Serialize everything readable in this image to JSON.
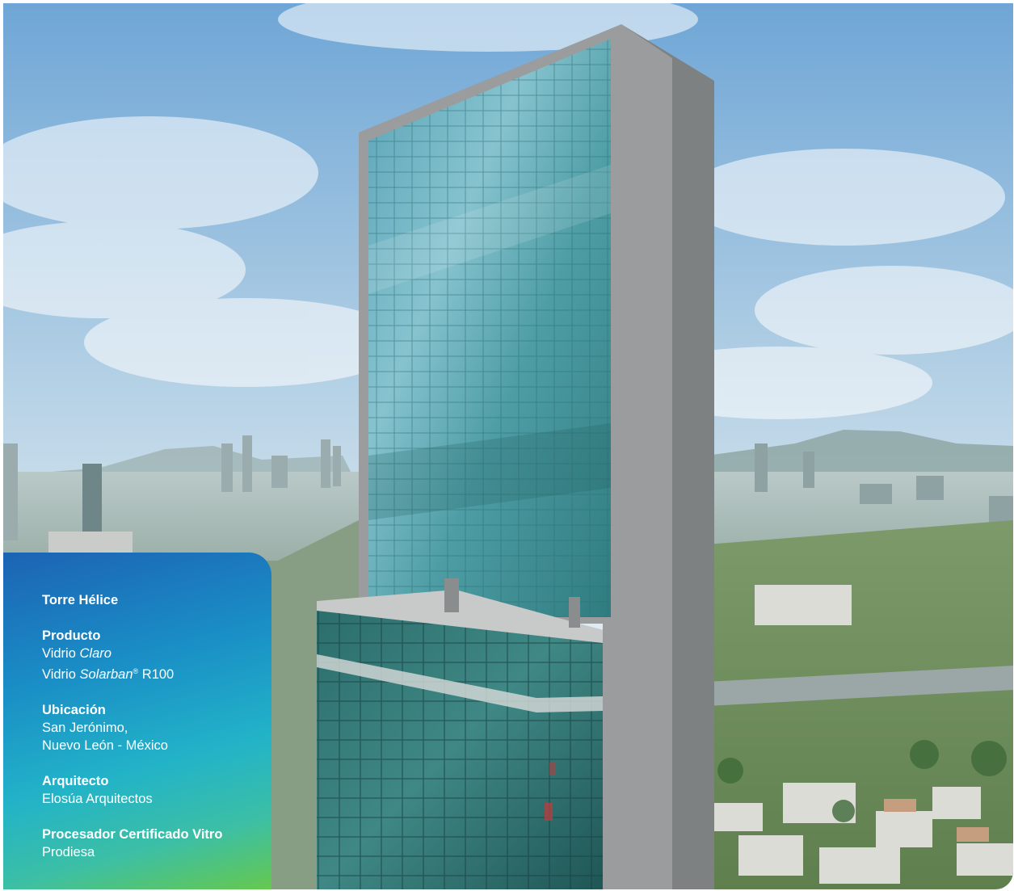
{
  "project": {
    "title": "Torre Hélice",
    "sections": [
      {
        "heading": "Producto",
        "lines": [
          {
            "prefix": "Vidrio ",
            "italic": "Claro",
            "sup": "",
            "suffix": ""
          },
          {
            "prefix": "Vidrio ",
            "italic": "Solarban",
            "sup": "®",
            "suffix": " R100"
          }
        ]
      },
      {
        "heading": "Ubicación",
        "lines": [
          "San Jerónimo,",
          "Nuevo León - México"
        ]
      },
      {
        "heading": "Arquitecto",
        "lines": [
          "Elosúa Arquitectos"
        ]
      },
      {
        "heading": "Procesador Certificado Vitro",
        "lines": [
          "Prodiesa"
        ]
      }
    ]
  },
  "colors": {
    "sky_top": "#7fb3dd",
    "sky_bottom": "#e9f1f4",
    "glass": "#3f8f97",
    "tower_frame": "#8d8f90",
    "panel_gradient": [
      "#1c63b4",
      "#22b3c8",
      "#66c84e"
    ]
  }
}
